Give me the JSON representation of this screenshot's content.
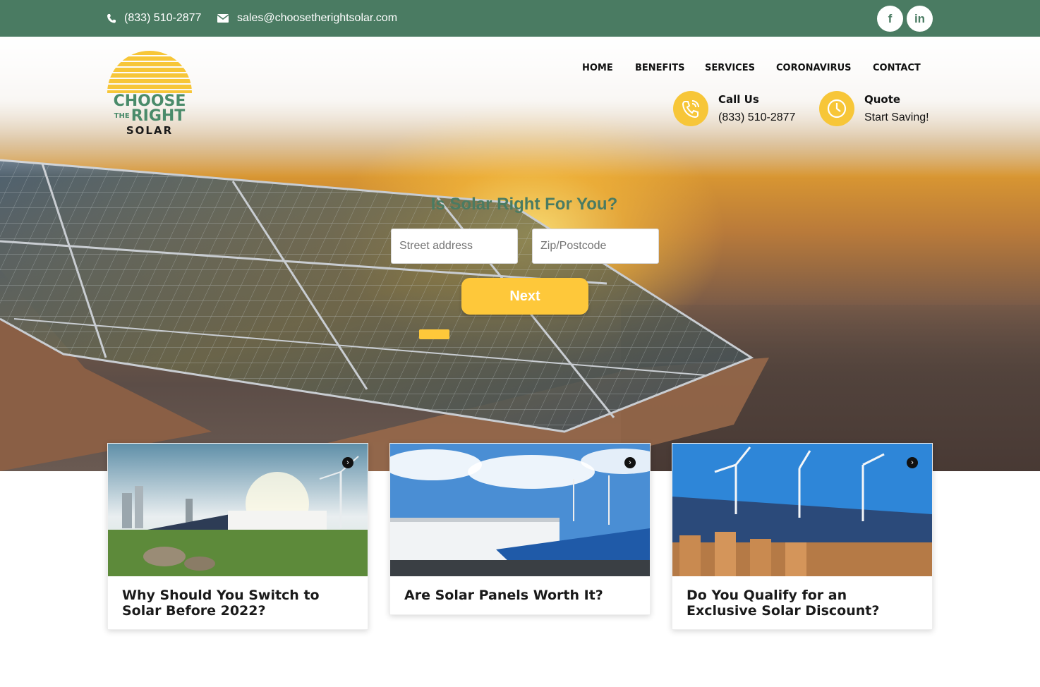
{
  "topbar": {
    "phone": "(833) 510-2877",
    "email": "sales@choosetherightsolar.com",
    "social": [
      {
        "label": "f",
        "icon": "facebook-icon"
      },
      {
        "label": "in",
        "icon": "linkedin-icon"
      }
    ]
  },
  "logo": {
    "line1": "CHOOSE",
    "line2_small": "THE",
    "line2": "RIGHT",
    "line3": "SOLAR"
  },
  "nav": {
    "items": [
      "HOME",
      "BENEFITS",
      "SERVICES",
      "CORONAVIRUS",
      "CONTACT"
    ]
  },
  "cta": {
    "call": {
      "title": "Call Us",
      "text": "(833) 510-2877",
      "icon": "phone-icon"
    },
    "quote": {
      "title": "Quote",
      "text": "Start Saving!",
      "icon": "clock-icon"
    }
  },
  "form": {
    "title": "Is Solar Right For You?",
    "street_placeholder": "Street address",
    "zip_placeholder": "Zip/Postcode",
    "next_label": "Next"
  },
  "cards": [
    {
      "title": "Why Should You Switch to Solar Before 2022?"
    },
    {
      "title": "Are Solar Panels Worth It?"
    },
    {
      "title": "Do You Qualify for an Exclusive Solar Discount?"
    }
  ],
  "colors": {
    "brand_green": "#4a7b62",
    "accent_yellow": "#fec83a"
  }
}
